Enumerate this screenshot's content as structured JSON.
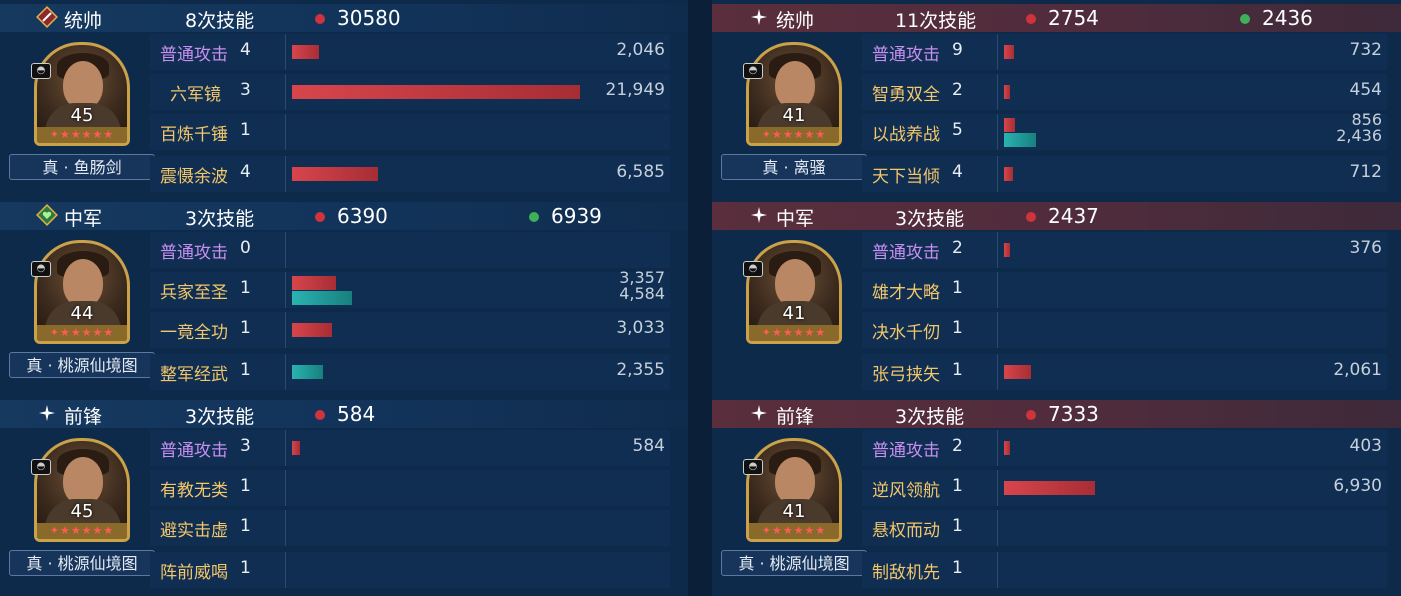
{
  "left": {
    "sections": [
      {
        "role": "统帅",
        "role_icon": "red-diamond-icon",
        "count": "8次技能",
        "damage": "30580",
        "heal": null,
        "level": "45",
        "treasure": "真 · 鱼肠剑",
        "skills": [
          {
            "name": "普通攻击",
            "num": "4",
            "type": "normal",
            "dmg": 2046,
            "dmg_label": "2,046",
            "heal": null,
            "heal_label": null
          },
          {
            "name": "六军镜",
            "num": "3",
            "type": "skill",
            "dmg": 21949,
            "dmg_label": "21,949",
            "heal": null,
            "heal_label": null
          },
          {
            "name": "百炼千锤",
            "num": "1",
            "type": "skill",
            "dmg": null,
            "dmg_label": null,
            "heal": null,
            "heal_label": null
          },
          {
            "name": "震慑余波",
            "num": "4",
            "type": "skill",
            "dmg": 6585,
            "dmg_label": "6,585",
            "heal": null,
            "heal_label": null
          }
        ]
      },
      {
        "role": "中军",
        "role_icon": "green-heart-diamond-icon",
        "count": "3次技能",
        "damage": "6390",
        "heal": "6939",
        "level": "44",
        "treasure": "真 · 桃源仙境图",
        "skills": [
          {
            "name": "普通攻击",
            "num": "0",
            "type": "normal",
            "dmg": null,
            "dmg_label": null,
            "heal": null,
            "heal_label": null
          },
          {
            "name": "兵家至圣",
            "num": "1",
            "type": "skill",
            "dmg": 3357,
            "dmg_label": "3,357",
            "heal": 4584,
            "heal_label": "4,584"
          },
          {
            "name": "一竟全功",
            "num": "1",
            "type": "skill",
            "dmg": 3033,
            "dmg_label": "3,033",
            "heal": null,
            "heal_label": null
          },
          {
            "name": "整军经武",
            "num": "1",
            "type": "skill",
            "dmg": null,
            "dmg_label": null,
            "heal": 2355,
            "heal_label": "2,355"
          }
        ]
      },
      {
        "role": "前锋",
        "role_icon": "sparkle-icon",
        "count": "3次技能",
        "damage": "584",
        "heal": null,
        "level": "45",
        "treasure": "真 · 桃源仙境图",
        "skills": [
          {
            "name": "普通攻击",
            "num": "3",
            "type": "normal",
            "dmg": 584,
            "dmg_label": "584",
            "heal": null,
            "heal_label": null
          },
          {
            "name": "有教无类",
            "num": "1",
            "type": "skill",
            "dmg": null,
            "dmg_label": null,
            "heal": null,
            "heal_label": null
          },
          {
            "name": "避实击虚",
            "num": "1",
            "type": "skill",
            "dmg": null,
            "dmg_label": null,
            "heal": null,
            "heal_label": null
          },
          {
            "name": "阵前威喝",
            "num": "1",
            "type": "skill",
            "dmg": null,
            "dmg_label": null,
            "heal": null,
            "heal_label": null
          }
        ]
      }
    ]
  },
  "right": {
    "sections": [
      {
        "role": "统帅",
        "role_icon": "sparkle-icon",
        "count": "11次技能",
        "damage": "2754",
        "heal": "2436",
        "level": "41",
        "treasure": "真 · 离骚",
        "skills": [
          {
            "name": "普通攻击",
            "num": "9",
            "type": "normal",
            "dmg": 732,
            "dmg_label": "732",
            "heal": null,
            "heal_label": null
          },
          {
            "name": "智勇双全",
            "num": "2",
            "type": "skill",
            "dmg": 454,
            "dmg_label": "454",
            "heal": null,
            "heal_label": null
          },
          {
            "name": "以战养战",
            "num": "5",
            "type": "skill",
            "dmg": 856,
            "dmg_label": "856",
            "heal": 2436,
            "heal_label": "2,436"
          },
          {
            "name": "天下当倾",
            "num": "4",
            "type": "skill",
            "dmg": 712,
            "dmg_label": "712",
            "heal": null,
            "heal_label": null
          }
        ]
      },
      {
        "role": "中军",
        "role_icon": "sparkle-icon",
        "count": "3次技能",
        "damage": "2437",
        "heal": null,
        "level": "41",
        "treasure": null,
        "skills": [
          {
            "name": "普通攻击",
            "num": "2",
            "type": "normal",
            "dmg": 376,
            "dmg_label": "376",
            "heal": null,
            "heal_label": null
          },
          {
            "name": "雄才大略",
            "num": "1",
            "type": "skill",
            "dmg": null,
            "dmg_label": null,
            "heal": null,
            "heal_label": null
          },
          {
            "name": "决水千仞",
            "num": "1",
            "type": "skill",
            "dmg": null,
            "dmg_label": null,
            "heal": null,
            "heal_label": null
          },
          {
            "name": "张弓挟矢",
            "num": "1",
            "type": "skill",
            "dmg": 2061,
            "dmg_label": "2,061",
            "heal": null,
            "heal_label": null
          }
        ]
      },
      {
        "role": "前锋",
        "role_icon": "sparkle-icon",
        "count": "3次技能",
        "damage": "7333",
        "heal": null,
        "level": "41",
        "treasure": "真 · 桃源仙境图",
        "skills": [
          {
            "name": "普通攻击",
            "num": "2",
            "type": "normal",
            "dmg": 403,
            "dmg_label": "403",
            "heal": null,
            "heal_label": null
          },
          {
            "name": "逆风领航",
            "num": "1",
            "type": "skill",
            "dmg": 6930,
            "dmg_label": "6,930",
            "heal": null,
            "heal_label": null
          },
          {
            "name": "悬权而动",
            "num": "1",
            "type": "skill",
            "dmg": null,
            "dmg_label": null,
            "heal": null,
            "heal_label": null
          },
          {
            "name": "制敌机先",
            "num": "1",
            "type": "skill",
            "dmg": null,
            "dmg_label": null,
            "heal": null,
            "heal_label": null
          }
        ]
      }
    ]
  },
  "colors": {
    "damage": "#d0333c",
    "heal": "#2ab3b0",
    "normal_attack": "#c78ff0",
    "skill": "#f2c66a"
  }
}
